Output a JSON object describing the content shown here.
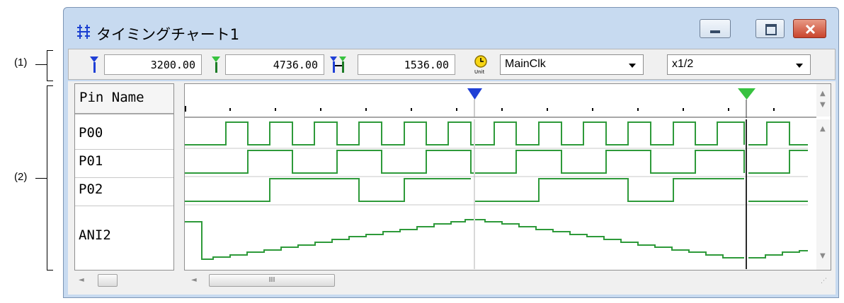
{
  "annotations": {
    "label1": "(1)",
    "label2": "(2)"
  },
  "window": {
    "title": "タイミングチャート1",
    "icons": {
      "app": "timing-chart-icon",
      "minimize": "minimize-icon",
      "maximize": "maximize-icon",
      "close": "close-icon"
    }
  },
  "toolbar": {
    "marker1": {
      "icon": "blue-marker-icon",
      "value": "3200.00"
    },
    "marker2": {
      "icon": "green-marker-icon",
      "value": "4736.00"
    },
    "marker_diff": {
      "icon": "marker-difference-icon",
      "value": "1536.00"
    },
    "unit_icon": "unit-clock-icon",
    "clock_select": "MainClk",
    "scale_select": "x1/2"
  },
  "pin_header": "Pin Name",
  "pins": [
    {
      "name": "P00"
    },
    {
      "name": "P01"
    },
    {
      "name": "P02"
    },
    {
      "name": "ANI2"
    }
  ],
  "scrollbar": {
    "thumb_glyph": "III"
  },
  "colors": {
    "signal": "#2e9a3a",
    "marker1": "#1f3fd6",
    "marker2": "#37c23f",
    "window_frame": "#c7daf0"
  }
}
